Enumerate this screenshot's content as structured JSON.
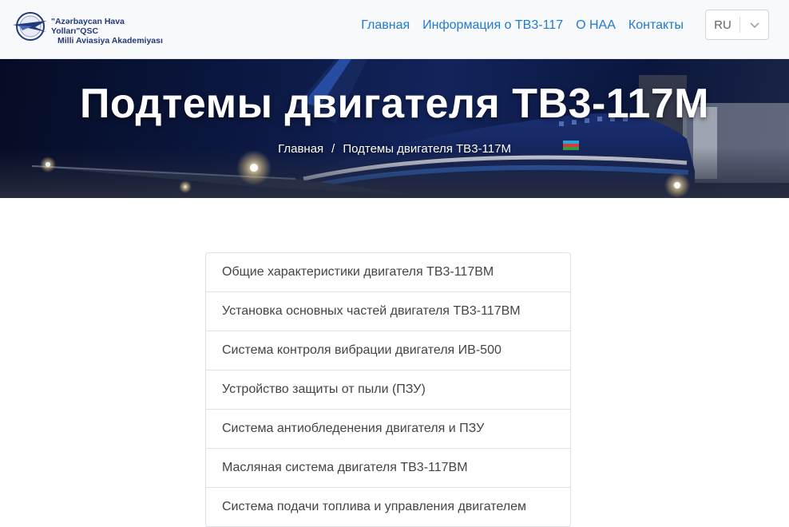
{
  "brand": {
    "line1": "\"Azərbaycan Hava Yolları\"QSC",
    "line2": "Milli Aviasiya Akademiyası",
    "colors": {
      "primary": "#233a7a",
      "link": "#1f7ad1"
    }
  },
  "nav": {
    "items": [
      {
        "label": "Главная"
      },
      {
        "label": "Информация о ТВ3-117"
      },
      {
        "label": "О НАА"
      },
      {
        "label": "Контакты"
      }
    ]
  },
  "language": {
    "selected": "RU",
    "icon": "chevron-down-icon"
  },
  "hero": {
    "title": "Подтемы двигателя ТВ3-117М",
    "breadcrumb": {
      "home": "Главная",
      "separator": "/",
      "current": "Подтемы двигателя ТВ3-117М"
    }
  },
  "topics": [
    "Общие характеристики двигателя ТВ3-117ВМ",
    "Установка основных частей двигателя ТВ3-117ВМ",
    "Система контроля вибрации двигателя ИВ-500",
    "Устройство защиты от пыли (ПЗУ)",
    "Система антиобледенения двигателя и ПЗУ",
    "Масляная система двигателя ТВ3-117ВМ",
    "Система подачи топлива и управления двигателем"
  ]
}
